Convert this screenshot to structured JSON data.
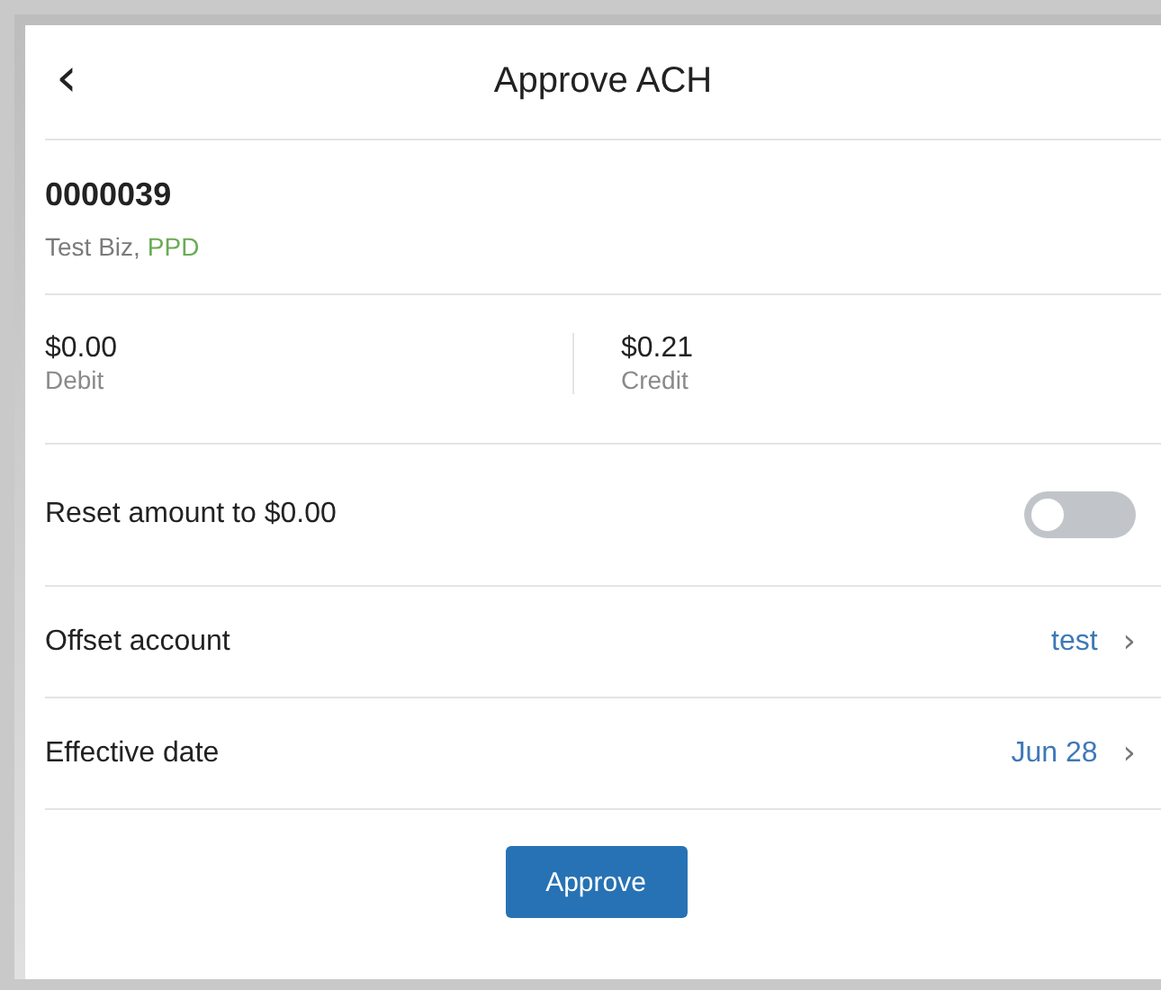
{
  "header": {
    "back": "‹",
    "title": "Approve ACH"
  },
  "entry": {
    "number": "0000039",
    "company": "Test Biz,",
    "entry_class": "PPD"
  },
  "amounts": [
    {
      "value": "$0.00",
      "label": "Debit"
    },
    {
      "value": "$0.21",
      "label": "Credit"
    }
  ],
  "rows": [
    {
      "kind": "toggle",
      "label": "Reset amount to $0.00",
      "on": false
    },
    {
      "kind": "link",
      "label": "Offset account",
      "value": "test",
      "chevron": "›"
    },
    {
      "kind": "link",
      "label": "Effective date",
      "value": "Jun 28",
      "chevron": "›"
    }
  ],
  "button": "Approve"
}
